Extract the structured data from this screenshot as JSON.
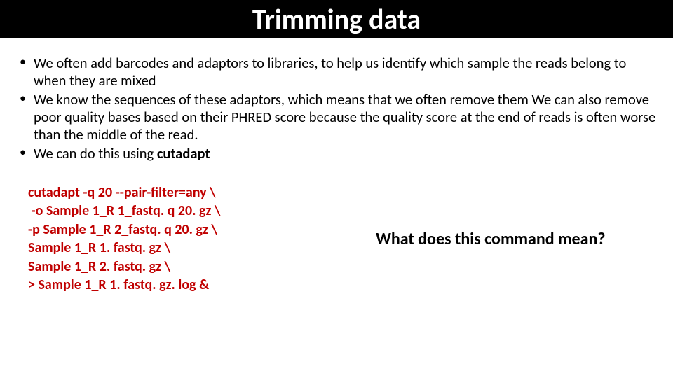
{
  "title": "Trimming data",
  "bullets": [
    {
      "text": "We often add barcodes and adaptors to libraries, to help us identify which sample the reads belong to when they are mixed"
    },
    {
      "text": "We know the sequences of these adaptors, which means that we often remove them We can also remove poor quality bases based on their PHRED score because the quality score at the end of reads is often worse than the middle of the read."
    },
    {
      "prefix": "We can do this using ",
      "bold": "cutadapt"
    }
  ],
  "code": [
    "cutadapt -q 20 --pair-filter=any \\",
    " -o Sample 1_R 1_fastq. q 20. gz \\",
    "-p Sample 1_R 2_fastq. q 20. gz \\",
    "Sample 1_R 1. fastq. gz \\",
    "Sample 1_R 2. fastq. gz \\",
    "> Sample 1_R 1. fastq. gz. log &"
  ],
  "question": "What does this command mean?"
}
